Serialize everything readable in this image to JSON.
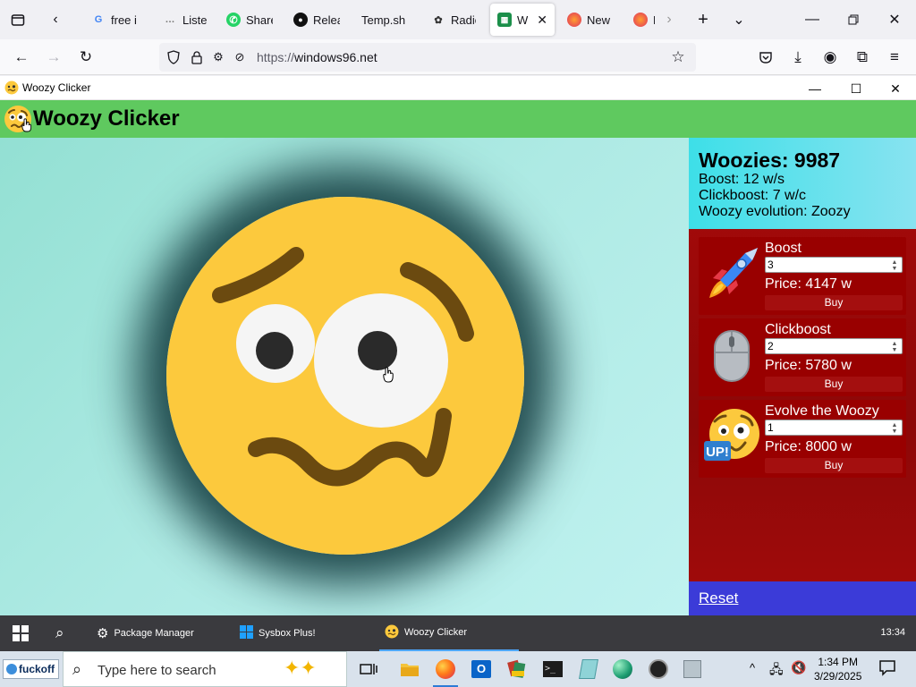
{
  "browser": {
    "tabs": [
      {
        "label": "free i",
        "icon": "google-icon"
      },
      {
        "label": "Liste",
        "icon": "document-icon"
      },
      {
        "label": "Share",
        "icon": "whatsapp-icon"
      },
      {
        "label": "Relea",
        "icon": "github-icon"
      },
      {
        "label": "Temp.sh |",
        "icon": "blank-icon"
      },
      {
        "label": "Radio",
        "icon": "radio-icon"
      },
      {
        "label": "Wi",
        "icon": "windows96-icon",
        "active": true
      },
      {
        "label": "New",
        "icon": "firefox-icon"
      },
      {
        "label": "N",
        "icon": "firefox-icon"
      }
    ],
    "url_prefix": "https://",
    "url_host": "windows96.net"
  },
  "window": {
    "title": "Woozy Clicker"
  },
  "game": {
    "header": "Woozy Clicker",
    "stats": {
      "woozies": "Woozies: 9987",
      "boost": "Boost: 12 w/s",
      "clickboost": "Clickboost: 7 w/c",
      "evolution": "Woozy evolution: Zoozy"
    },
    "shop": [
      {
        "name": "Boost",
        "qty": "3",
        "price": "Price: 4147 w",
        "buy": "Buy",
        "icon": "rocket-icon"
      },
      {
        "name": "Clickboost",
        "qty": "2",
        "price": "Price: 5780 w",
        "buy": "Buy",
        "icon": "mouse-icon"
      },
      {
        "name": "Evolve the Woozy",
        "qty": "1",
        "price": "Price: 8000 w",
        "buy": "Buy",
        "icon": "woozy-up-icon"
      }
    ],
    "reset": "Reset"
  },
  "w96taskbar": {
    "items": [
      {
        "label": "Package Manager",
        "icon": "gear-icon"
      },
      {
        "label": "Sysbox Plus!",
        "icon": "windows-logo-icon"
      },
      {
        "label": "Woozy Clicker",
        "icon": "woozy-icon",
        "active": true
      }
    ],
    "clock": "13:34"
  },
  "wintaskbar": {
    "start_label": "fuckoff",
    "search_placeholder": "Type here to search",
    "time": "1:34 PM",
    "date": "3/29/2025"
  },
  "colors": {
    "header_green": "#5fc95f",
    "sidebar_red": "#990000",
    "stats_cyan": "#3ddfe8",
    "reset_blue": "#3b3bd8",
    "woozy_yellow": "#fcc93d"
  }
}
